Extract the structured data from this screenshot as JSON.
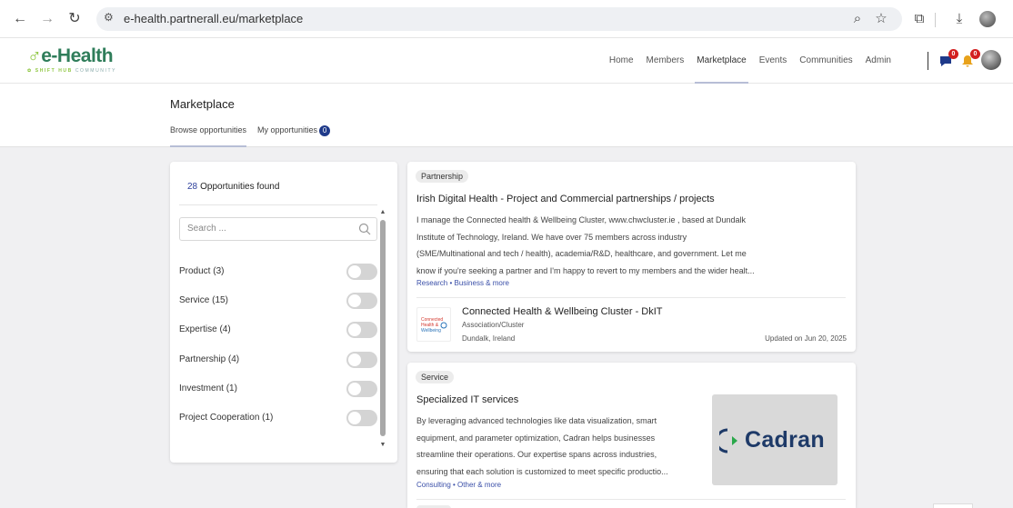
{
  "browser": {
    "url": "e-health.partnerall.eu/marketplace"
  },
  "site": {
    "logo_text": "e-Health",
    "logo_sub": "COMMUNITY",
    "nav": [
      "Home",
      "Members",
      "Marketplace",
      "Events",
      "Communities",
      "Admin"
    ],
    "active_nav": "Marketplace",
    "messages_badge": "0",
    "notifications_badge": "0"
  },
  "page": {
    "title": "Marketplace",
    "tabs": [
      {
        "label": "Browse opportunities",
        "active": true
      },
      {
        "label": "My opportunities",
        "count": "0"
      }
    ]
  },
  "filters": {
    "count": "28",
    "count_label": "Opportunities found",
    "search_placeholder": "Search ...",
    "items": [
      {
        "label": "Product (3)",
        "on": false
      },
      {
        "label": "Service (15)",
        "on": false
      },
      {
        "label": "Expertise (4)",
        "on": false
      },
      {
        "label": "Partnership (4)",
        "on": false
      },
      {
        "label": "Investment (1)",
        "on": false
      },
      {
        "label": "Project Cooperation (1)",
        "on": false
      }
    ]
  },
  "cards": [
    {
      "tag": "Partnership",
      "title": "Irish Digital Health - Project and Commercial partnerships / projects",
      "desc": [
        "I manage the Connected health & Wellbeing Cluster, www.chwcluster.ie , based at Dundalk",
        "Institute of Technology, Ireland. We have over 75 members across industry",
        "(SME/Multinational and tech / health), academia/R&D, healthcare, and government. Let me",
        "know if you're seeking a partner and I'm happy to revert to my members and the wider healt..."
      ],
      "categories": "Research • Business & more",
      "org": {
        "name": "Connected Health & Wellbeing Cluster - DkIT",
        "type": "Association/Cluster",
        "location": "Dundalk,  Ireland",
        "updated": "Updated on Jun 20, 2025"
      }
    },
    {
      "tag": "Service",
      "title": "Specialized IT services",
      "desc": [
        "By leveraging advanced technologies like data visualization, smart",
        "equipment, and parameter optimization, Cadran helps businesses",
        "streamline their operations. Our expertise spans across industries,",
        "ensuring that each solution is customized to meet specific productio..."
      ],
      "categories": "Consulting • Other & more",
      "image_logo": "Cadran"
    }
  ],
  "colors": {
    "brand_green": "#2f7d5a",
    "accent_blue": "#2d3f9c",
    "badge_red": "#d32020"
  }
}
